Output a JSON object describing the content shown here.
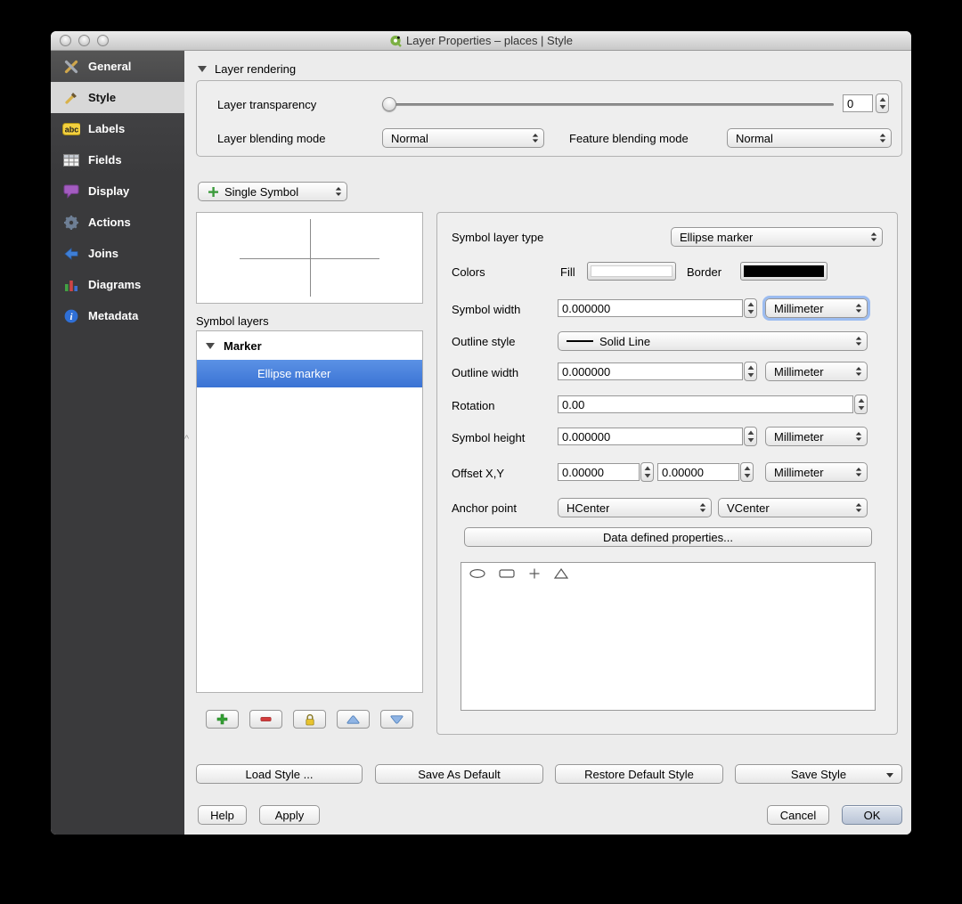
{
  "window": {
    "title": "Layer Properties – places | Style"
  },
  "sidebar": {
    "items": [
      {
        "label": "General"
      },
      {
        "label": "Style"
      },
      {
        "label": "Labels"
      },
      {
        "label": "Fields"
      },
      {
        "label": "Display"
      },
      {
        "label": "Actions"
      },
      {
        "label": "Joins"
      },
      {
        "label": "Diagrams"
      },
      {
        "label": "Metadata"
      }
    ]
  },
  "rendering": {
    "section_label": "Layer rendering",
    "transparency_label": "Layer transparency",
    "transparency_value": "0",
    "blending_label": "Layer blending mode",
    "blending_value": "Normal",
    "feature_blending_label": "Feature blending mode",
    "feature_blending_value": "Normal"
  },
  "symbol": {
    "renderer_value": "Single Symbol",
    "symbol_layers_label": "Symbol layers",
    "tree_group_label": "Marker",
    "tree_child_label": "Ellipse marker"
  },
  "properties": {
    "symbol_layer_type_label": "Symbol layer type",
    "symbol_layer_type_value": "Ellipse marker",
    "colors_label": "Colors",
    "fill_label": "Fill",
    "border_label": "Border",
    "symbol_width_label": "Symbol width",
    "symbol_width_value": "0.000000",
    "symbol_width_unit": "Millimeter",
    "outline_style_label": "Outline style",
    "outline_style_value": "Solid Line",
    "outline_width_label": "Outline width",
    "outline_width_value": "0.000000",
    "outline_width_unit": "Millimeter",
    "rotation_label": "Rotation",
    "rotation_value": "0.00",
    "symbol_height_label": "Symbol height",
    "symbol_height_value": "0.000000",
    "symbol_height_unit": "Millimeter",
    "offset_label": "Offset X,Y",
    "offset_x_value": "0.00000",
    "offset_y_value": "0.00000",
    "offset_unit": "Millimeter",
    "anchor_label": "Anchor point",
    "anchor_h_value": "HCenter",
    "anchor_v_value": "VCenter",
    "data_defined_button": "Data defined properties..."
  },
  "preview_symbols": [
    "ellipse",
    "rectangle",
    "cross",
    "triangle"
  ],
  "style_buttons": {
    "load": "Load Style ...",
    "save_default": "Save As Default",
    "restore": "Restore Default Style",
    "save": "Save Style"
  },
  "dialog_buttons": {
    "help": "Help",
    "apply": "Apply",
    "cancel": "Cancel",
    "ok": "OK"
  },
  "colors": {
    "selection": "#3b77d8",
    "fill_swatch": "#ffffff",
    "border_swatch": "#000000"
  }
}
